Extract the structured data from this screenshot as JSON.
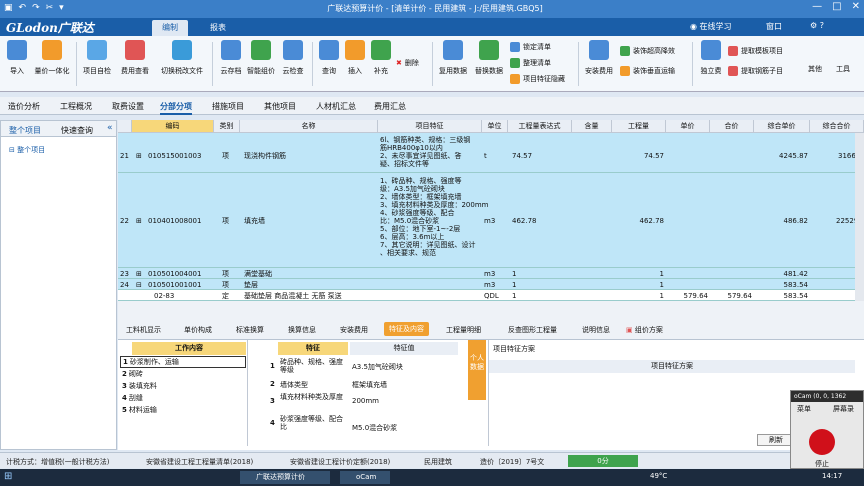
{
  "window": {
    "title": "广联达预算计价 - [清单计价 - 民用建筑 - J:/民用建筑.GBQ5]",
    "min": "—",
    "max": "□",
    "close": "✕"
  },
  "menu": {
    "logo": "GLodon广联达",
    "tabs": [
      "编制",
      "报表"
    ],
    "online": "在线学习",
    "window": "窗口"
  },
  "ribbon": {
    "big": [
      "导入",
      "量价一体化",
      "项目自检",
      "费用查看",
      "切换税改文件",
      "云存档",
      "智能组价",
      "云检查",
      "查询",
      "插入",
      "补充",
      "删除",
      "复用数据",
      "替换数据",
      "安装费用",
      "独立费",
      "其他",
      "工具"
    ],
    "small": [
      "锁定清单",
      "整理清单",
      "项目特征隐藏",
      "装饰超高降效",
      "装饰垂直运输",
      "提取模板项目",
      "提取钢筋子目"
    ]
  },
  "navtabs": [
    "造价分析",
    "工程概况",
    "取费设置",
    "分部分项",
    "措施项目",
    "其他项目",
    "人材机汇总",
    "费用汇总"
  ],
  "leftpanel": {
    "tabs": [
      "整个项目",
      "快速查询"
    ],
    "tree_root": "整个项目"
  },
  "grid": {
    "headers": [
      "编码",
      "类别",
      "名称",
      "项目特征",
      "单位",
      "工程量表达式",
      "含量",
      "工程量",
      "单价",
      "合价",
      "综合单价",
      "综合合价"
    ],
    "rows": [
      {
        "num": "21",
        "code": "010515001003",
        "type": "项",
        "name": "现浇构件钢筋",
        "feature": "6l、钢筋种类、规格：三级钢\n筋HRB400φ10以内\n2、未尽事宜详见图纸、答\n疑、招标文件等",
        "unit": "t",
        "expr": "74.57",
        "qty": "74.57",
        "unit_price": "",
        "total": "",
        "comp_price": "4245.87",
        "comp_total": "3166"
      },
      {
        "num": "22",
        "code": "010401008001",
        "type": "项",
        "name": "填充墙",
        "feature": "1、砖品种、规格、强度等\n级：A3.5加气砼砌块\n2、墙体类型：框架填充墙\n3、填充材料种类及厚度：200mm\n4、砂浆强度等级、配合\n比：M5.0混合砂浆\n5、部位：地下室-1~-2层\n6、层高：3.6m以上\n7、其它说明：详见图纸、设计\n、相关要求、规范",
        "unit": "m3",
        "expr": "462.78",
        "qty": "462.78",
        "unit_price": "",
        "total": "",
        "comp_price": "486.82",
        "comp_total": "22529"
      },
      {
        "num": "23",
        "code": "010501004001",
        "type": "项",
        "name": "满堂基础",
        "feature": "",
        "unit": "m3",
        "expr": "1",
        "qty": "1",
        "unit_price": "",
        "total": "",
        "comp_price": "481.42",
        "comp_total": ""
      },
      {
        "num": "24",
        "code": "010501001001",
        "type": "项",
        "name": "垫层",
        "feature": "",
        "unit": "m3",
        "expr": "1",
        "qty": "1",
        "unit_price": "",
        "total": "",
        "comp_price": "583.54",
        "comp_total": ""
      },
      {
        "num": "",
        "code": "02-83",
        "type": "定",
        "name": "基础垫层 商品混凝土 无筋 泵送",
        "feature": "",
        "unit": "QDL",
        "expr": "1",
        "qty": "1",
        "unit_price": "579.64",
        "total": "579.64",
        "comp_price": "583.54",
        "comp_total": ""
      }
    ]
  },
  "bottomtabs": [
    "工料机显示",
    "单价构成",
    "标准换算",
    "换算信息",
    "安装费用",
    "特征及内容",
    "工程量明细",
    "反查图形工程量",
    "说明信息",
    "组价方案"
  ],
  "work_content": {
    "header": "工作内容",
    "items": [
      "砂浆制作、运输",
      "砌砖",
      "装填充料",
      "刮缝",
      "材料运输"
    ]
  },
  "features": {
    "header_f": "特征",
    "header_v": "特征值",
    "rows": [
      {
        "n": "1",
        "f": "砖品种、规格、强度等级",
        "v": "A3.5加气砼砌块"
      },
      {
        "n": "2",
        "f": "墙体类型",
        "v": "框架填充墙"
      },
      {
        "n": "3",
        "f": "填充材料种类及厚度",
        "v": "200mm"
      },
      {
        "n": "4",
        "f": "砂浆强度等级、配合比",
        "v": "M5.0混合砂浆"
      }
    ]
  },
  "scheme": {
    "side": "个人数据",
    "title": "项目特征方案",
    "col": "项目特征方案",
    "refresh": "刷新"
  },
  "status": {
    "method": "计税方式：增值税(一般计税方法)",
    "list": "安徽省建设工程工程量清单(2018)",
    "quota": "安徽省建设工程计价定额(2018)",
    "type": "民用建筑",
    "file": "造价〔2019〕7号文",
    "score": "0分"
  },
  "ocam": {
    "title": "oCam (0, 0, 1362",
    "menu": "菜单",
    "screen": "屏幕录",
    "stop": "停止"
  },
  "taskbar": {
    "app": "广联达预算计价",
    "ocam": "oCam",
    "temp": "49°C",
    "time": "14:17"
  }
}
